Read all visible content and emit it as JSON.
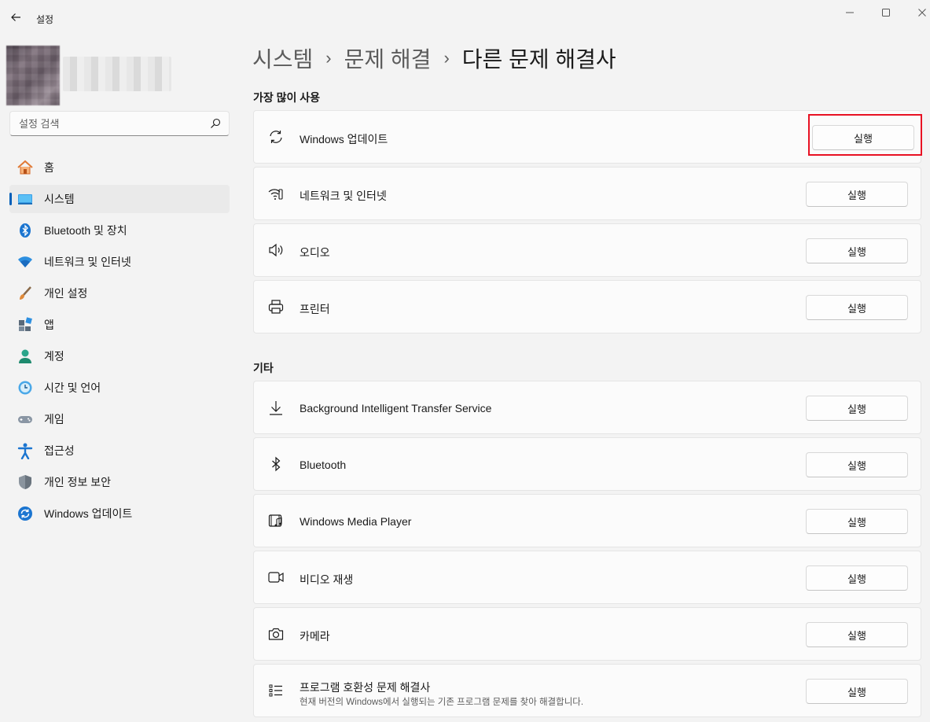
{
  "window": {
    "title": "설정"
  },
  "sidebar": {
    "search_placeholder": "설정 검색",
    "items": [
      {
        "label": "홈",
        "icon": "home-icon"
      },
      {
        "label": "시스템",
        "icon": "system-icon",
        "active": true
      },
      {
        "label": "Bluetooth 및 장치",
        "icon": "bluetooth-devices-icon"
      },
      {
        "label": "네트워크 및 인터넷",
        "icon": "wifi-icon"
      },
      {
        "label": "개인 설정",
        "icon": "brush-icon"
      },
      {
        "label": "앱",
        "icon": "apps-icon"
      },
      {
        "label": "계정",
        "icon": "account-icon"
      },
      {
        "label": "시간 및 언어",
        "icon": "time-language-icon"
      },
      {
        "label": "게임",
        "icon": "gamepad-icon"
      },
      {
        "label": "접근성",
        "icon": "accessibility-icon"
      },
      {
        "label": "개인 정보 보안",
        "icon": "shield-icon"
      },
      {
        "label": "Windows 업데이트",
        "icon": "windows-update-icon"
      }
    ]
  },
  "breadcrumb": {
    "items": [
      "시스템",
      "문제 해결"
    ],
    "separator": "›",
    "current": "다른 문제 해결사"
  },
  "sections": {
    "most_used": {
      "title": "가장 많이 사용",
      "items": [
        {
          "label": "Windows 업데이트",
          "icon": "refresh-icon",
          "button": "실행"
        },
        {
          "label": "네트워크 및 인터넷",
          "icon": "network-icon",
          "button": "실행"
        },
        {
          "label": "오디오",
          "icon": "speaker-icon",
          "button": "실행"
        },
        {
          "label": "프린터",
          "icon": "printer-icon",
          "button": "실행"
        }
      ]
    },
    "other": {
      "title": "기타",
      "items": [
        {
          "label": "Background Intelligent Transfer Service",
          "icon": "download-icon",
          "button": "실행"
        },
        {
          "label": "Bluetooth",
          "icon": "bluetooth-icon",
          "button": "실행"
        },
        {
          "label": "Windows Media Player",
          "icon": "media-player-icon",
          "button": "실행"
        },
        {
          "label": "비디오 재생",
          "icon": "video-icon",
          "button": "실행"
        },
        {
          "label": "카메라",
          "icon": "camera-icon",
          "button": "실행"
        },
        {
          "label": "프로그램 호환성 문제 해결사",
          "description": "현재 버전의 Windows에서 실행되는 기존 프로그램 문제를 찾아 해결합니다.",
          "icon": "list-icon",
          "button": "실행"
        }
      ]
    }
  },
  "colors": {
    "accent": "#005fb8",
    "highlight": "#e81123",
    "background": "#f3f3f3",
    "card": "#fbfbfb"
  }
}
